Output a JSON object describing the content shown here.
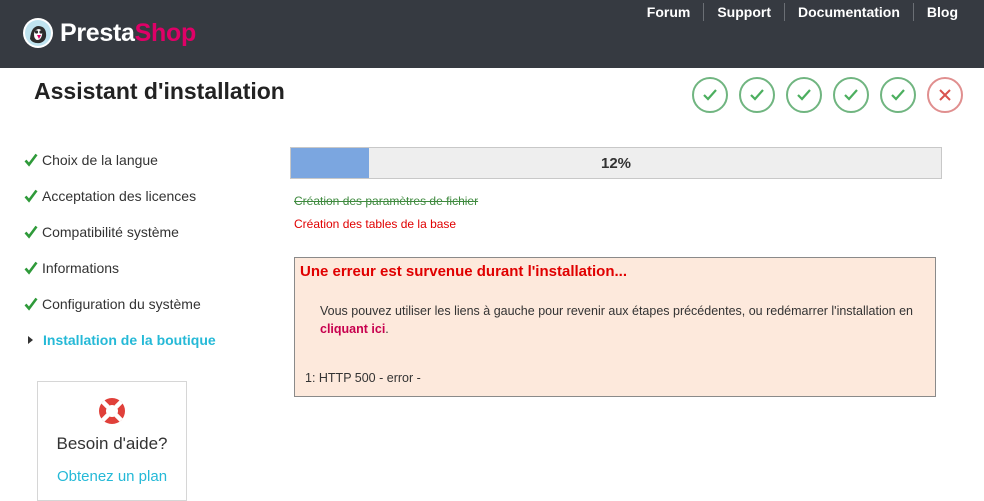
{
  "header": {
    "logo_part1": "Presta",
    "logo_part2": "Shop",
    "nav": [
      "Forum",
      "Support",
      "Documentation",
      "Blog"
    ]
  },
  "title": "Assistant d'installation",
  "steps_status": [
    "done",
    "done",
    "done",
    "done",
    "done",
    "error"
  ],
  "sidebar": {
    "items": [
      {
        "label": "Choix de la langue",
        "state": "done"
      },
      {
        "label": "Acceptation des licences",
        "state": "done"
      },
      {
        "label": "Compatibilité système",
        "state": "done"
      },
      {
        "label": "Informations",
        "state": "done"
      },
      {
        "label": "Configuration du système",
        "state": "done"
      },
      {
        "label": "Installation de la boutique",
        "state": "active"
      }
    ]
  },
  "help": {
    "title": "Besoin d'aide?",
    "link": "Obtenez un plan"
  },
  "progress": {
    "value": 0.12,
    "label": "12%"
  },
  "tasks": {
    "done": "Création des paramètres de fichier",
    "failed": "Création des tables de la base"
  },
  "error": {
    "title": "Une erreur est survenue durant l'installation...",
    "text_before": "Vous pouvez utiliser les liens à gauche pour revenir aux étapes précédentes, ou redémarrer l'installation en ",
    "retry_link": "cliquant ici",
    "text_after": ".",
    "detail": "1: HTTP 500 - error -"
  },
  "colors": {
    "header_bg": "#363a41",
    "brand_pink": "#df0067",
    "accent_blue": "#25b9d7",
    "check_green": "#70b580",
    "error_red": "#e00000",
    "progress_fill": "#7ba6e0",
    "error_bg": "#fde9dc"
  }
}
